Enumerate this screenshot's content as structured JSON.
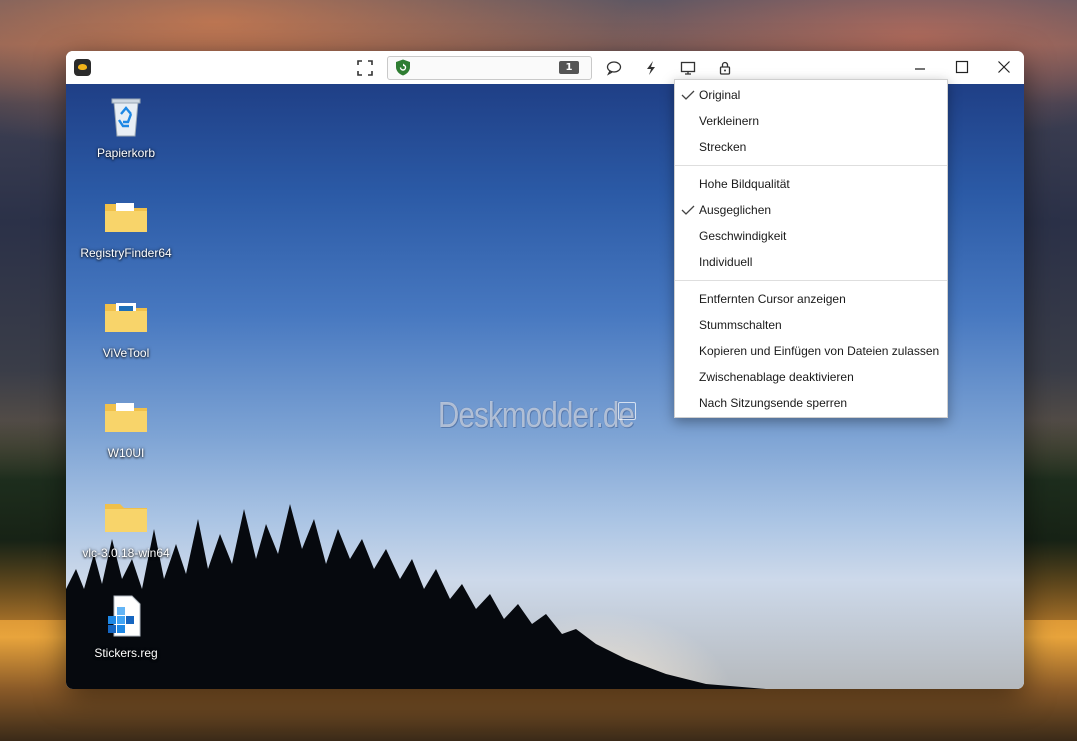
{
  "toolbar": {
    "fullscreen_icon": "fullscreen-icon",
    "session_id_badge": "1",
    "chat_icon": "chat-bubble-icon",
    "actions_icon": "lightning-icon",
    "display_icon": "monitor-icon",
    "lock_icon": "lock-icon"
  },
  "desktop": {
    "watermark": "Deskmodder.de",
    "icons": [
      {
        "label": "Papierkorb",
        "icon": "recycle-bin-icon"
      },
      {
        "label": "RegistryFinder64",
        "icon": "folder-icon"
      },
      {
        "label": "ViVeTool",
        "icon": "folder-icon"
      },
      {
        "label": "W10UI",
        "icon": "folder-icon"
      },
      {
        "label": "vlc-3.0.18-win64",
        "icon": "folder-icon"
      },
      {
        "label": "Stickers.reg",
        "icon": "registry-file-icon"
      }
    ]
  },
  "menu": {
    "scaling": [
      {
        "label": "Original",
        "checked": true
      },
      {
        "label": "Verkleinern",
        "checked": false
      },
      {
        "label": "Strecken",
        "checked": false
      }
    ],
    "quality": [
      {
        "label": "Hohe Bildqualität",
        "checked": false
      },
      {
        "label": "Ausgeglichen",
        "checked": true
      },
      {
        "label": "Geschwindigkeit",
        "checked": false
      },
      {
        "label": "Individuell",
        "checked": false
      }
    ],
    "options": [
      {
        "label": "Entfernten Cursor anzeigen"
      },
      {
        "label": "Stummschalten"
      },
      {
        "label": "Kopieren und Einfügen von Dateien zulassen"
      },
      {
        "label": "Zwischenablage deaktivieren"
      },
      {
        "label": "Nach Sitzungsende sperren"
      }
    ]
  },
  "colors": {
    "accent_shield": "#2e7d32",
    "folder_yellow": "#f8d46a",
    "menu_bg": "#ffffff"
  }
}
